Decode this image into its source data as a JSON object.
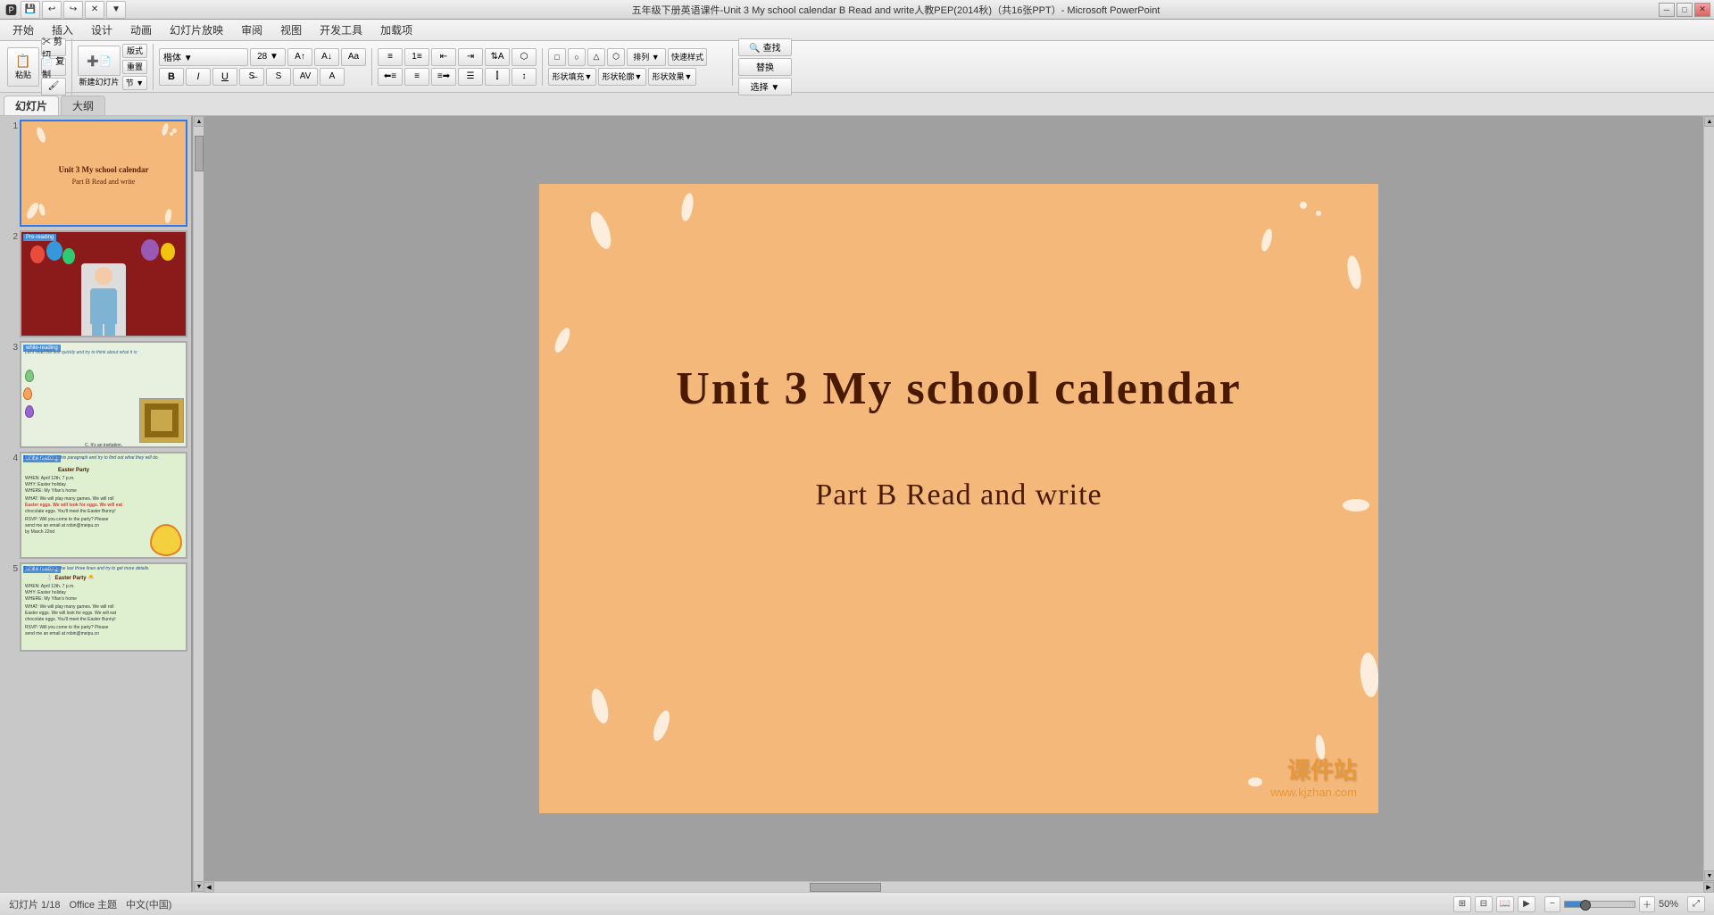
{
  "window": {
    "title": "五年级下册英语课件-Unit 3 My school calendar B Read and write人教PEP(2014秋)（共16张PPT）- Microsoft PowerPoint",
    "controls": [
      "minimize",
      "restore",
      "close"
    ]
  },
  "quickaccess": {
    "buttons": [
      "save",
      "undo",
      "redo",
      "close-file",
      "customize"
    ]
  },
  "menubar": {
    "items": [
      "开始",
      "插入",
      "设计",
      "动画",
      "幻灯片放映",
      "审阅",
      "视图",
      "开发工具",
      "加载项"
    ]
  },
  "tabs": {
    "items": [
      "幻灯片",
      "大纲"
    ]
  },
  "slides": [
    {
      "number": "1",
      "type": "title",
      "title": "Unit 3 My school calendar",
      "subtitle": "Part B Read and write"
    },
    {
      "number": "2",
      "type": "prereading",
      "tag": "Pre-reading"
    },
    {
      "number": "3",
      "type": "while-reading",
      "tag": "while-reading",
      "text": "Let's read the text quickly and try to think about what it is:",
      "label": "C. It's an invitation."
    },
    {
      "number": "4",
      "type": "while-reading-task2",
      "tag": "while-reading",
      "task": "Task 2: Let's read this paragraph and try to find out what they will do.",
      "event": "Easter Party"
    },
    {
      "number": "5",
      "type": "while-reading-task3",
      "tag": "while-reading",
      "task": "Task 3: Let's read the last three lines and try to get more details."
    }
  ],
  "main_slide": {
    "title": "Unit 3  My school calendar",
    "subtitle": "Part B  Read and write",
    "background_color": "#f4b97a"
  },
  "status": {
    "slide_info": "幻灯片 1/18",
    "theme": "Office 主题",
    "language": "中文(中国)",
    "zoom": "50%",
    "zoom_value": 50
  },
  "watermark": {
    "brand": "课件站",
    "url": "www.kjzhan.com"
  }
}
